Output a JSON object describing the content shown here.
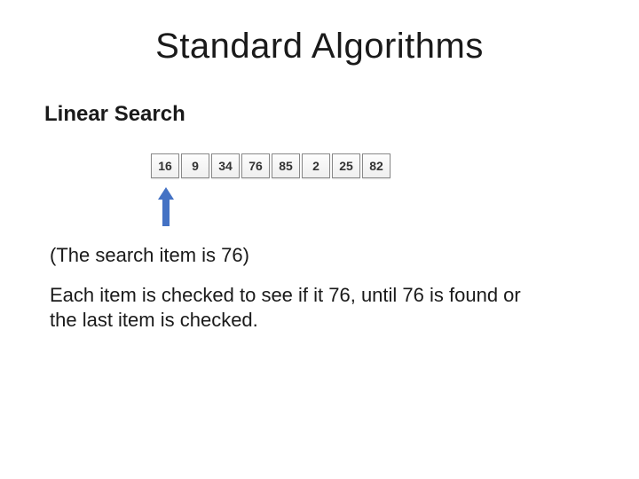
{
  "title": "Standard Algorithms",
  "subtitle": "Linear Search",
  "array": [
    "16",
    "9",
    "34",
    "76",
    "85",
    "2",
    "25",
    "82"
  ],
  "note": "(The search item is 76)",
  "description": "Each item is checked to see if it 76, until 76 is found or the last item is checked.",
  "arrow_color": "#4472c4"
}
